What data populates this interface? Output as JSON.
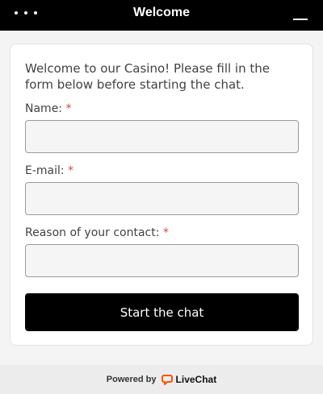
{
  "header": {
    "title": "Welcome",
    "menu_icon": "more-dots-icon",
    "minimize_icon": "minimize-icon"
  },
  "form": {
    "intro": "Welcome to our Casino! Please fill in the form below before starting the chat.",
    "required_mark": "*",
    "fields": [
      {
        "label": "Name:",
        "value": "",
        "placeholder": ""
      },
      {
        "label": "E-mail:",
        "value": "",
        "placeholder": ""
      },
      {
        "label": "Reason of your contact:",
        "value": "",
        "placeholder": ""
      }
    ],
    "submit_label": "Start the chat"
  },
  "footer": {
    "powered_by": "Powered by",
    "brand": "LiveChat",
    "logo_icon": "livechat-logo-icon"
  },
  "colors": {
    "header_bg": "#000000",
    "button_bg": "#000000",
    "required": "#d64646",
    "brand_accent": "#ff5100"
  }
}
